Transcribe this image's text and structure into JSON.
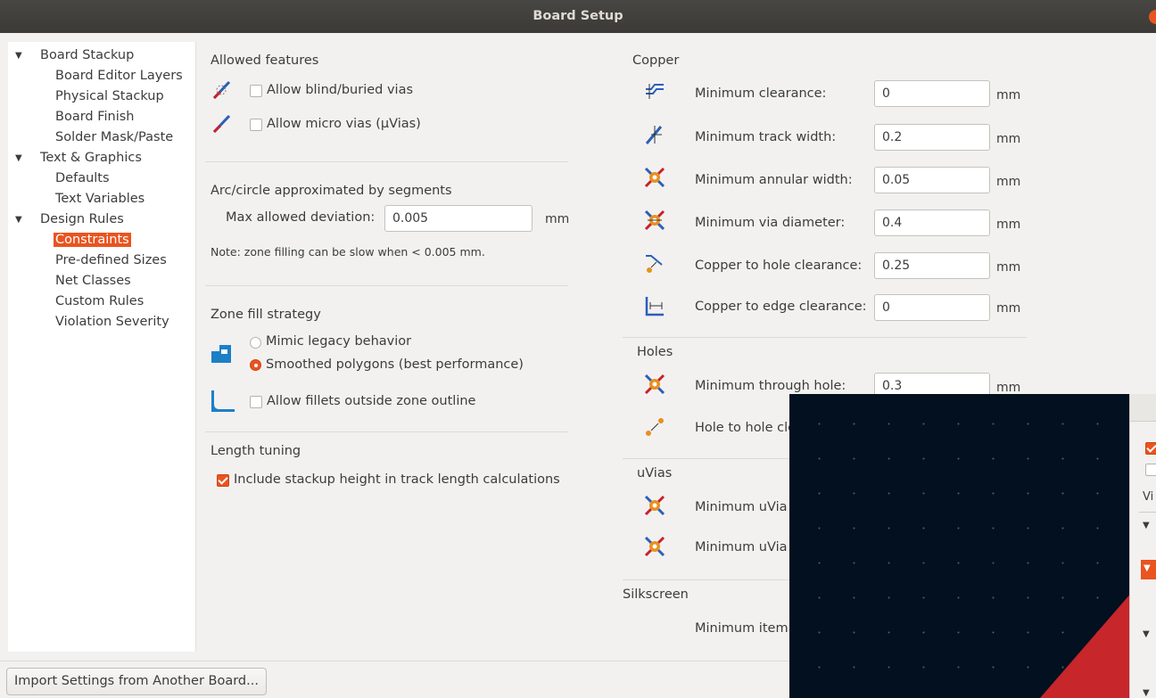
{
  "window": {
    "title": "Board Setup"
  },
  "tree": {
    "items": [
      {
        "label": "Board Stackup",
        "level": 0,
        "expanded": true
      },
      {
        "label": "Board Editor Layers",
        "level": 1
      },
      {
        "label": "Physical Stackup",
        "level": 1
      },
      {
        "label": "Board Finish",
        "level": 1
      },
      {
        "label": "Solder Mask/Paste",
        "level": 1
      },
      {
        "label": "Text & Graphics",
        "level": 0,
        "expanded": true
      },
      {
        "label": "Defaults",
        "level": 1
      },
      {
        "label": "Text Variables",
        "level": 1
      },
      {
        "label": "Design Rules",
        "level": 0,
        "expanded": true
      },
      {
        "label": "Constraints",
        "level": 1,
        "selected": true
      },
      {
        "label": "Pre-defined Sizes",
        "level": 1
      },
      {
        "label": "Net Classes",
        "level": 1
      },
      {
        "label": "Custom Rules",
        "level": 1
      },
      {
        "label": "Violation Severity",
        "level": 1
      }
    ]
  },
  "allowed_features": {
    "title": "Allowed features",
    "blind_vias": {
      "label": "Allow blind/buried vias",
      "checked": false
    },
    "micro_vias": {
      "label": "Allow micro vias (μVias)",
      "checked": false
    }
  },
  "arc": {
    "title": "Arc/circle approximated by segments",
    "max_dev_label": "Max allowed deviation:",
    "max_dev_value": "0.005",
    "unit": "mm",
    "note": "Note: zone filling can be slow when < 0.005 mm."
  },
  "zone_fill": {
    "title": "Zone fill strategy",
    "legacy": {
      "label": "Mimic legacy behavior",
      "checked": false
    },
    "smoothed": {
      "label": "Smoothed polygons (best performance)",
      "checked": true
    },
    "fillets": {
      "label": "Allow fillets outside zone outline",
      "checked": false
    }
  },
  "length_tuning": {
    "title": "Length tuning",
    "stackup": {
      "label": "Include stackup height in track length calculations",
      "checked": true
    }
  },
  "copper": {
    "title": "Copper",
    "rows": [
      {
        "label": "Minimum clearance:",
        "value": "0",
        "unit": "mm",
        "icon": "clearance-icon"
      },
      {
        "label": "Minimum track width:",
        "value": "0.2",
        "unit": "mm",
        "icon": "track-width-icon"
      },
      {
        "label": "Minimum annular width:",
        "value": "0.05",
        "unit": "mm",
        "icon": "annular-width-icon"
      },
      {
        "label": "Minimum via diameter:",
        "value": "0.4",
        "unit": "mm",
        "icon": "via-diameter-icon"
      },
      {
        "label": "Copper to hole clearance:",
        "value": "0.25",
        "unit": "mm",
        "icon": "hole-clearance-icon"
      },
      {
        "label": "Copper to edge clearance:",
        "value": "0",
        "unit": "mm",
        "icon": "edge-clearance-icon"
      }
    ]
  },
  "holes": {
    "title": "Holes",
    "rows": [
      {
        "label": "Minimum through hole:",
        "value": "0.3",
        "unit": "mm",
        "icon": "through-hole-icon"
      },
      {
        "label": "Hole to hole cle",
        "icon": "hole-to-hole-icon"
      }
    ]
  },
  "uvias": {
    "title": "uVias",
    "rows": [
      {
        "label": "Minimum uVia",
        "icon": "uvia-hole-icon"
      },
      {
        "label": "Minimum uVia",
        "icon": "uvia-diameter-icon"
      }
    ]
  },
  "silkscreen": {
    "title": "Silkscreen",
    "rows": [
      {
        "label": "Minimum item"
      }
    ]
  },
  "footer": {
    "import_button": "Import Settings from Another Board..."
  },
  "overlay": {
    "side_partial_label": "Vi"
  },
  "colors": {
    "accent": "#e95420",
    "titlebar": "#3c3b37",
    "overlay_bg": "#03101f",
    "overlay_red": "#c7262b"
  }
}
